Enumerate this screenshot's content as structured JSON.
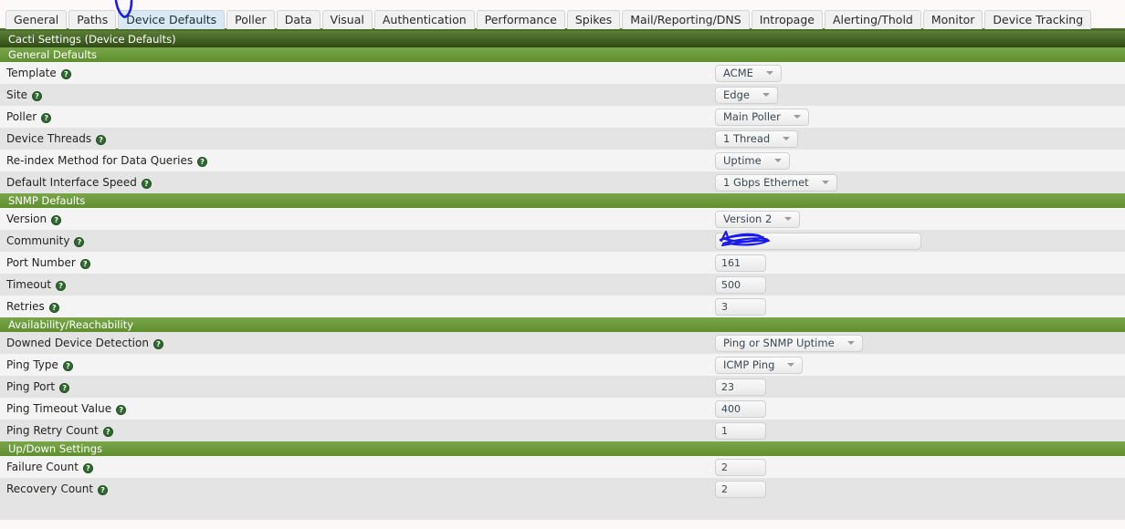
{
  "tabs": [
    {
      "label": "General",
      "active": false
    },
    {
      "label": "Paths",
      "active": false
    },
    {
      "label": "Device Defaults",
      "active": true
    },
    {
      "label": "Poller",
      "active": false
    },
    {
      "label": "Data",
      "active": false
    },
    {
      "label": "Visual",
      "active": false
    },
    {
      "label": "Authentication",
      "active": false
    },
    {
      "label": "Performance",
      "active": false
    },
    {
      "label": "Spikes",
      "active": false
    },
    {
      "label": "Mail/Reporting/DNS",
      "active": false
    },
    {
      "label": "Intropage",
      "active": false
    },
    {
      "label": "Alerting/Thold",
      "active": false
    },
    {
      "label": "Monitor",
      "active": false
    },
    {
      "label": "Device Tracking",
      "active": false
    }
  ],
  "page_title": "Cacti Settings (Device Defaults)",
  "help_glyph": "?",
  "colors": {
    "title_bar_green": "#2f4a16",
    "section_green": "#5f8f2f",
    "active_tab_blue": "#d9e9f3",
    "row_odd": "#f4f4f4",
    "row_even": "#e4e4e4",
    "annotation_blue": "#1a1aee"
  },
  "sections": [
    {
      "heading": "General Defaults",
      "rows": [
        {
          "label": "Template",
          "type": "select",
          "value": "ACME"
        },
        {
          "label": "Site",
          "type": "select",
          "value": "Edge"
        },
        {
          "label": "Poller",
          "type": "select",
          "value": "Main Poller"
        },
        {
          "label": "Device Threads",
          "type": "select",
          "value": "1 Thread"
        },
        {
          "label": "Re-index Method for Data Queries",
          "type": "select",
          "value": "Uptime"
        },
        {
          "label": "Default Interface Speed",
          "type": "select",
          "value": "1 Gbps Ethernet"
        }
      ]
    },
    {
      "heading": "SNMP Defaults",
      "rows": [
        {
          "label": "Version",
          "type": "select",
          "value": "Version 2"
        },
        {
          "label": "Community",
          "type": "input-wide",
          "value": "",
          "redacted": true
        },
        {
          "label": "Port Number",
          "type": "input",
          "value": "161"
        },
        {
          "label": "Timeout",
          "type": "input",
          "value": "500"
        },
        {
          "label": "Retries",
          "type": "input",
          "value": "3"
        }
      ]
    },
    {
      "heading": "Availability/Reachability",
      "rows": [
        {
          "label": "Downed Device Detection",
          "type": "select",
          "value": "Ping or SNMP Uptime"
        },
        {
          "label": "Ping Type",
          "type": "select",
          "value": "ICMP Ping"
        },
        {
          "label": "Ping Port",
          "type": "input",
          "value": "23"
        },
        {
          "label": "Ping Timeout Value",
          "type": "input",
          "value": "400"
        },
        {
          "label": "Ping Retry Count",
          "type": "input",
          "value": "1"
        }
      ]
    },
    {
      "heading": "Up/Down Settings",
      "rows": [
        {
          "label": "Failure Count",
          "type": "input",
          "value": "2"
        },
        {
          "label": "Recovery Count",
          "type": "input",
          "value": "2"
        }
      ]
    }
  ],
  "annotations": {
    "tab_pointer": "hand-drawn blue arrow pointing at Device Defaults tab",
    "community_redaction": "hand-drawn blue scribble covering the SNMP community string"
  }
}
